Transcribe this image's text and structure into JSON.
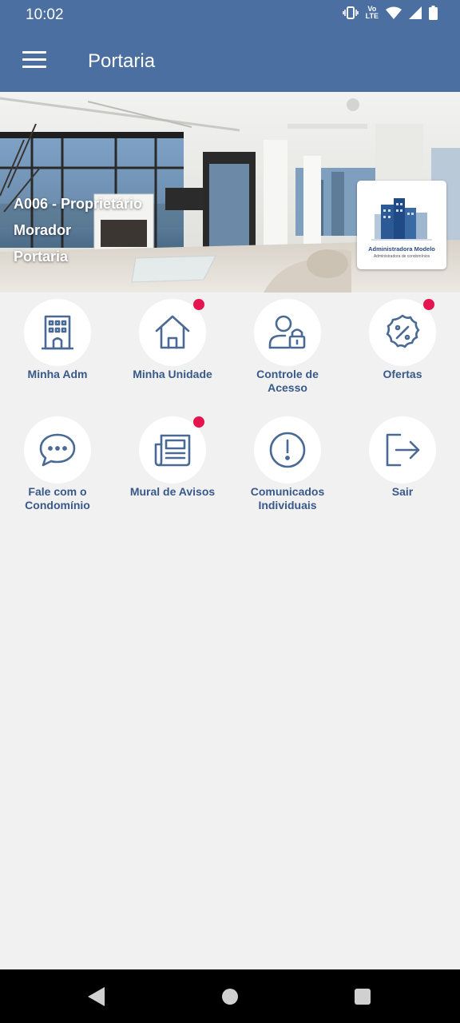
{
  "status_bar": {
    "time": "10:02",
    "network_top": "Vo",
    "network_bottom": "LTE"
  },
  "header": {
    "title": "Portaria"
  },
  "profile": {
    "unit_role": "A006 - Proprietário",
    "resident_type": "Morador",
    "profile_name": "Portaria"
  },
  "logo": {
    "name": "Administradora Modelo",
    "tagline": "Administradora de condomínios"
  },
  "menu": [
    {
      "label": "Minha Adm",
      "icon": "building-icon",
      "badge": false
    },
    {
      "label": "Minha Unidade",
      "icon": "home-icon",
      "badge": true
    },
    {
      "label": "Controle de\nAcesso",
      "icon": "user-lock-icon",
      "badge": false
    },
    {
      "label": "Ofertas",
      "icon": "discount-badge-icon",
      "badge": true
    },
    {
      "label": "Fale com o\nCondomínio",
      "icon": "chat-bubble-icon",
      "badge": false
    },
    {
      "label": "Mural de Avisos",
      "icon": "newspaper-icon",
      "badge": true
    },
    {
      "label": "Comunicados\nIndividuais",
      "icon": "alert-circle-icon",
      "badge": false
    },
    {
      "label": "Sair",
      "icon": "logout-icon",
      "badge": false
    }
  ],
  "colors": {
    "primary": "#4a6fa0",
    "icon": "#4a6a95",
    "label": "#38598a",
    "badge": "#e5134f",
    "background": "#f1f1f1"
  }
}
